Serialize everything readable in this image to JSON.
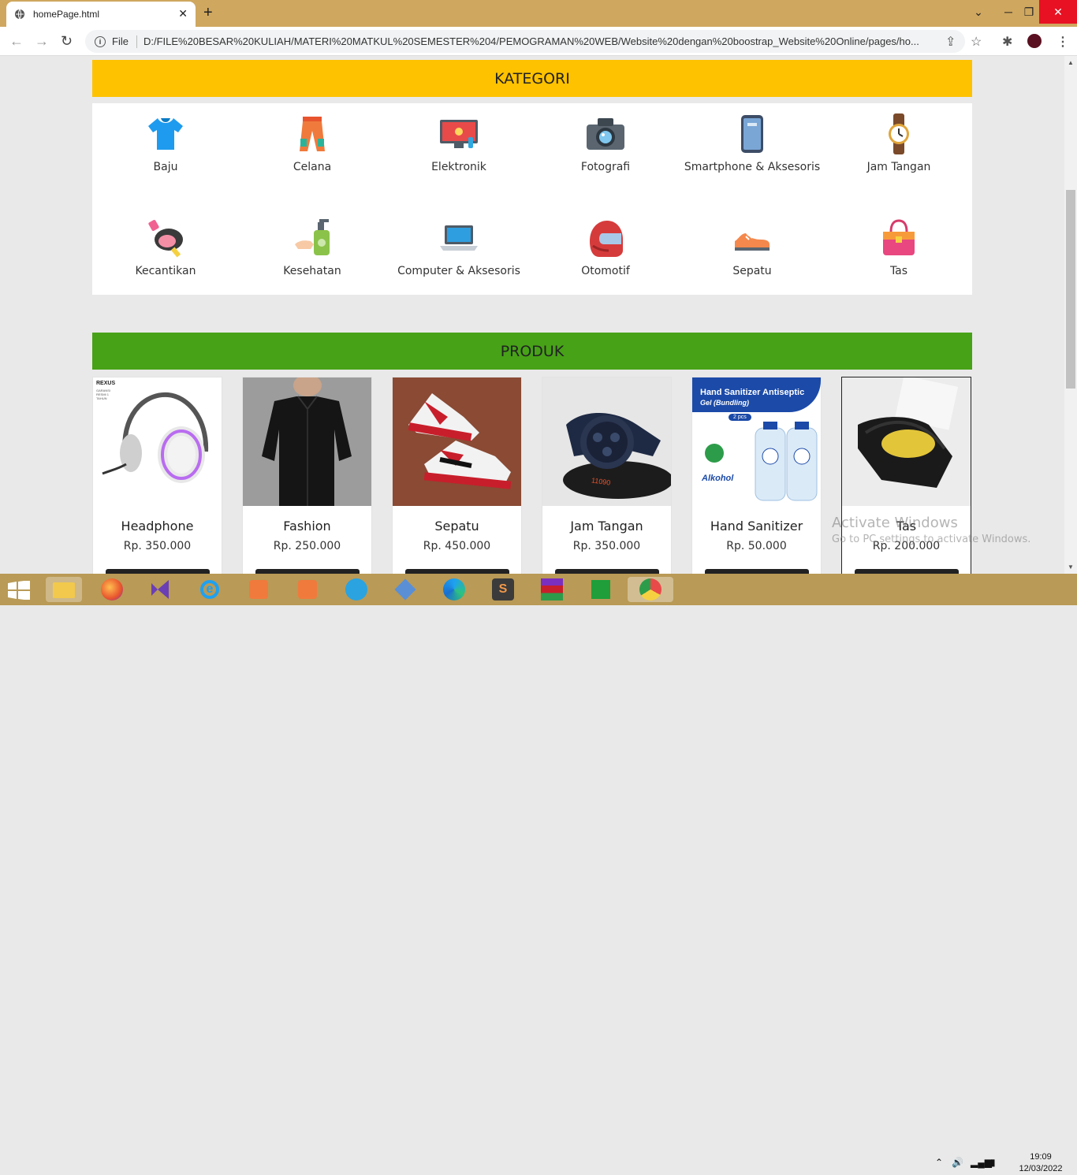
{
  "browser": {
    "tab_title": "homePage.html",
    "new_tab": "+",
    "file_label": "File",
    "url": "D:/FILE%20BESAR%20KULIAH/MATERI%20MATKUL%20SEMESTER%204/PEMOGRAMAN%20WEB/Website%20dengan%20boostrap_Website%20Online/pages/ho..."
  },
  "kategori": {
    "title": "KATEGORI",
    "items": [
      {
        "label": "Baju",
        "icon": "shirt-icon"
      },
      {
        "label": "Celana",
        "icon": "pants-icon"
      },
      {
        "label": "Elektronik",
        "icon": "monitor-icon"
      },
      {
        "label": "Fotografi",
        "icon": "camera-icon"
      },
      {
        "label": "Smartphone & Aksesoris",
        "icon": "smartphone-icon"
      },
      {
        "label": "Jam Tangan",
        "icon": "watch-icon"
      },
      {
        "label": "Kecantikan",
        "icon": "compact-icon"
      },
      {
        "label": "Kesehatan",
        "icon": "hand-sanitizer-icon"
      },
      {
        "label": "Computer & Aksesoris",
        "icon": "laptop-icon"
      },
      {
        "label": "Otomotif",
        "icon": "helmet-icon"
      },
      {
        "label": "Sepatu",
        "icon": "shoe-icon"
      },
      {
        "label": "Tas",
        "icon": "bag-icon"
      }
    ]
  },
  "produk": {
    "title": "PRODUK",
    "items": [
      {
        "name": "Headphone",
        "price": "Rp. 350.000",
        "brand": "REXUS",
        "sub": "GARANSI RESMI 1 TAHUN"
      },
      {
        "name": "Fashion",
        "price": "Rp. 250.000"
      },
      {
        "name": "Sepatu",
        "price": "Rp. 450.000"
      },
      {
        "name": "Jam Tangan",
        "price": "Rp. 350.000",
        "tag": "11090"
      },
      {
        "name": "Hand Sanitizer",
        "price": "Rp. 50.000",
        "banner": "Hand Sanitizer Antiseptic",
        "banner2": "Gel (Bundling)",
        "pcs": "2 pcs",
        "alkohol": "Alkohol"
      },
      {
        "name": "Tas",
        "price": "Rp. 200.000"
      }
    ]
  },
  "watermark": {
    "line1": "Activate Windows",
    "line2": "Go to PC settings to activate Windows."
  },
  "taskbar": {
    "time": "19:09",
    "date": "12/03/2022"
  },
  "colors": {
    "kategori": "#fec200",
    "produk": "#47a217",
    "tabbar": "#cfa75f",
    "taskbar": "#b99a56"
  }
}
